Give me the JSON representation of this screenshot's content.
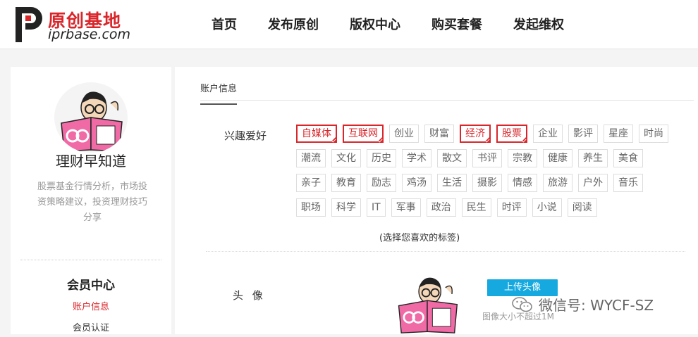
{
  "header": {
    "logo_cn": "原创基地",
    "logo_en": "iprbase.com",
    "nav": [
      "首页",
      "发布原创",
      "版权中心",
      "购买套餐",
      "发起维权"
    ]
  },
  "sidebar": {
    "username": "理财早知道",
    "bio": "股票基金行情分析，市场投资策略建议，投资理财技巧分享",
    "member_center": "会员中心",
    "links": [
      "账户信息",
      "会员认证"
    ]
  },
  "main": {
    "tab": "账户信息",
    "interest_label": "兴趣爱好",
    "tag_rows": [
      [
        {
          "label": "自媒体",
          "selected": true
        },
        {
          "label": "互联网",
          "selected": true
        },
        {
          "label": "创业",
          "selected": false
        },
        {
          "label": "财富",
          "selected": false
        },
        {
          "label": "经济",
          "selected": true
        },
        {
          "label": "股票",
          "selected": true
        },
        {
          "label": "企业",
          "selected": false
        },
        {
          "label": "影评",
          "selected": false
        },
        {
          "label": "星座",
          "selected": false
        },
        {
          "label": "时尚",
          "selected": false
        }
      ],
      [
        {
          "label": "潮流",
          "selected": false
        },
        {
          "label": "文化",
          "selected": false
        },
        {
          "label": "历史",
          "selected": false
        },
        {
          "label": "学术",
          "selected": false
        },
        {
          "label": "散文",
          "selected": false
        },
        {
          "label": "书评",
          "selected": false
        },
        {
          "label": "宗教",
          "selected": false
        },
        {
          "label": "健康",
          "selected": false
        },
        {
          "label": "养生",
          "selected": false
        },
        {
          "label": "美食",
          "selected": false
        }
      ],
      [
        {
          "label": "亲子",
          "selected": false
        },
        {
          "label": "教育",
          "selected": false
        },
        {
          "label": "励志",
          "selected": false
        },
        {
          "label": "鸡汤",
          "selected": false
        },
        {
          "label": "生活",
          "selected": false
        },
        {
          "label": "摄影",
          "selected": false
        },
        {
          "label": "情感",
          "selected": false
        },
        {
          "label": "旅游",
          "selected": false
        },
        {
          "label": "户外",
          "selected": false
        },
        {
          "label": "音乐",
          "selected": false
        }
      ],
      [
        {
          "label": "职场",
          "selected": false
        },
        {
          "label": "科学",
          "selected": false
        },
        {
          "label": "IT",
          "selected": false
        },
        {
          "label": "军事",
          "selected": false
        },
        {
          "label": "政治",
          "selected": false
        },
        {
          "label": "民生",
          "selected": false
        },
        {
          "label": "时评",
          "selected": false
        },
        {
          "label": "小说",
          "selected": false
        },
        {
          "label": "阅读",
          "selected": false
        }
      ]
    ],
    "tags_hint": "(选择您喜欢的标签)",
    "avatar_label": "头 像",
    "upload_button": "上传头像",
    "upload_hint": "图像大小不超过1M"
  },
  "watermark": "微信号: WYCF-SZ",
  "colors": {
    "brand_red": "#d9262b",
    "upload_blue": "#15a9e0"
  }
}
